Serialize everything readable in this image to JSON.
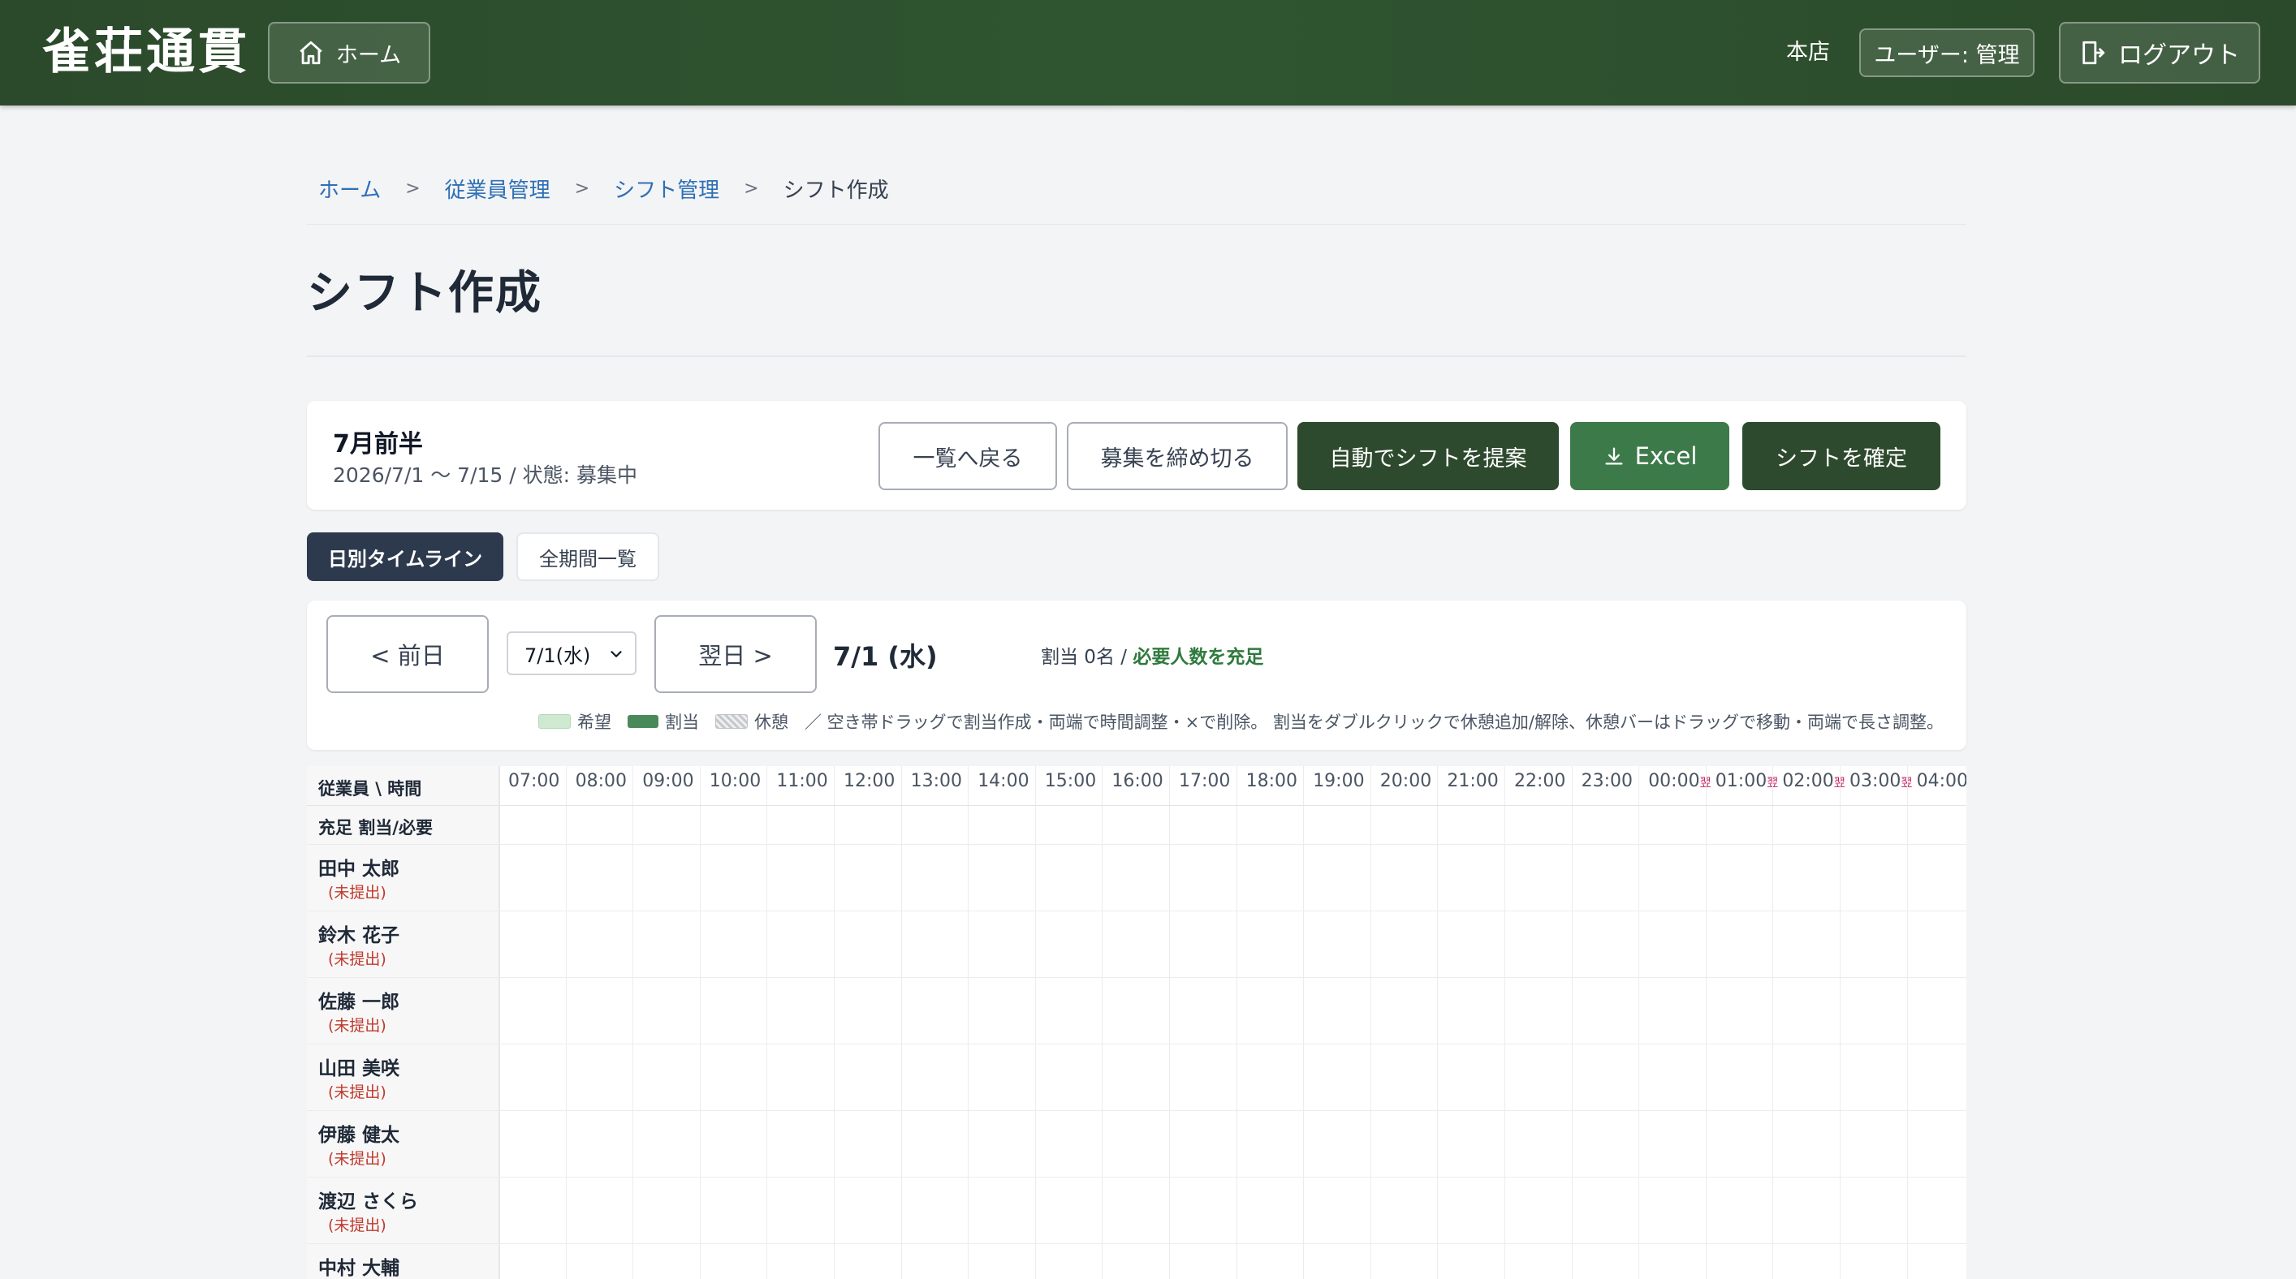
{
  "header": {
    "brand": "雀荘通貫",
    "home_label": "ホーム",
    "store": "本店",
    "user_label": "ユーザー: 管理",
    "logout_label": "ログアウト"
  },
  "breadcrumb": {
    "items": [
      "ホーム",
      "従業員管理",
      "シフト管理"
    ],
    "current": "シフト作成",
    "separator": ">"
  },
  "page_title": "シフト作成",
  "period": {
    "title": "7月前半",
    "subtitle": "2026/7/1 〜 7/15 / 状態: 募集中",
    "buttons": {
      "back": "一覧へ戻る",
      "close": "募集を締め切る",
      "auto": "自動でシフトを提案",
      "excel": "Excel",
      "confirm": "シフトを確定"
    }
  },
  "tabs": {
    "daily": "日別タイムライン",
    "all": "全期間一覧"
  },
  "day_nav": {
    "prev": "< 前日",
    "select_value": "7/1(水)",
    "next": "翌日 >",
    "heading": "7/1 (水)",
    "status_prefix": "割当 0名 / ",
    "status_ok": "必要人数を充足"
  },
  "legend": {
    "want": "希望",
    "assign": "割当",
    "break": "休憩",
    "instructions": "／ 空き帯ドラッグで割当作成・両端で時間調整・×で削除。 割当をダブルクリックで休憩追加/解除、休憩バーはドラッグで移動・両端で長さ調整。"
  },
  "grid": {
    "corner_label": "従業員 \\ 時間",
    "fill_label": "充足 割当/必要",
    "hours": [
      "07:00",
      "08:00",
      "09:00",
      "10:00",
      "11:00",
      "12:00",
      "13:00",
      "14:00",
      "15:00",
      "16:00",
      "17:00",
      "18:00",
      "19:00",
      "20:00",
      "21:00",
      "22:00",
      "23:00",
      "00:00",
      "01:00",
      "02:00",
      "03:00",
      "04:00"
    ],
    "next_day_mark": "翌",
    "employees": [
      {
        "name": "田中 太郎",
        "status": "(未提出)"
      },
      {
        "name": "鈴木 花子",
        "status": "(未提出)"
      },
      {
        "name": "佐藤 一郎",
        "status": "(未提出)"
      },
      {
        "name": "山田 美咲",
        "status": "(未提出)"
      },
      {
        "name": "伊藤 健太",
        "status": "(未提出)"
      },
      {
        "name": "渡辺 さくら",
        "status": "(未提出)"
      },
      {
        "name": "中村 大輔",
        "status": ""
      }
    ]
  },
  "colors": {
    "header_bg": "#2f5530",
    "accent_dark": "#2e4a2e",
    "accent_green": "#3d7a4a",
    "link": "#2f6fb5",
    "warning": "#c0392b"
  }
}
